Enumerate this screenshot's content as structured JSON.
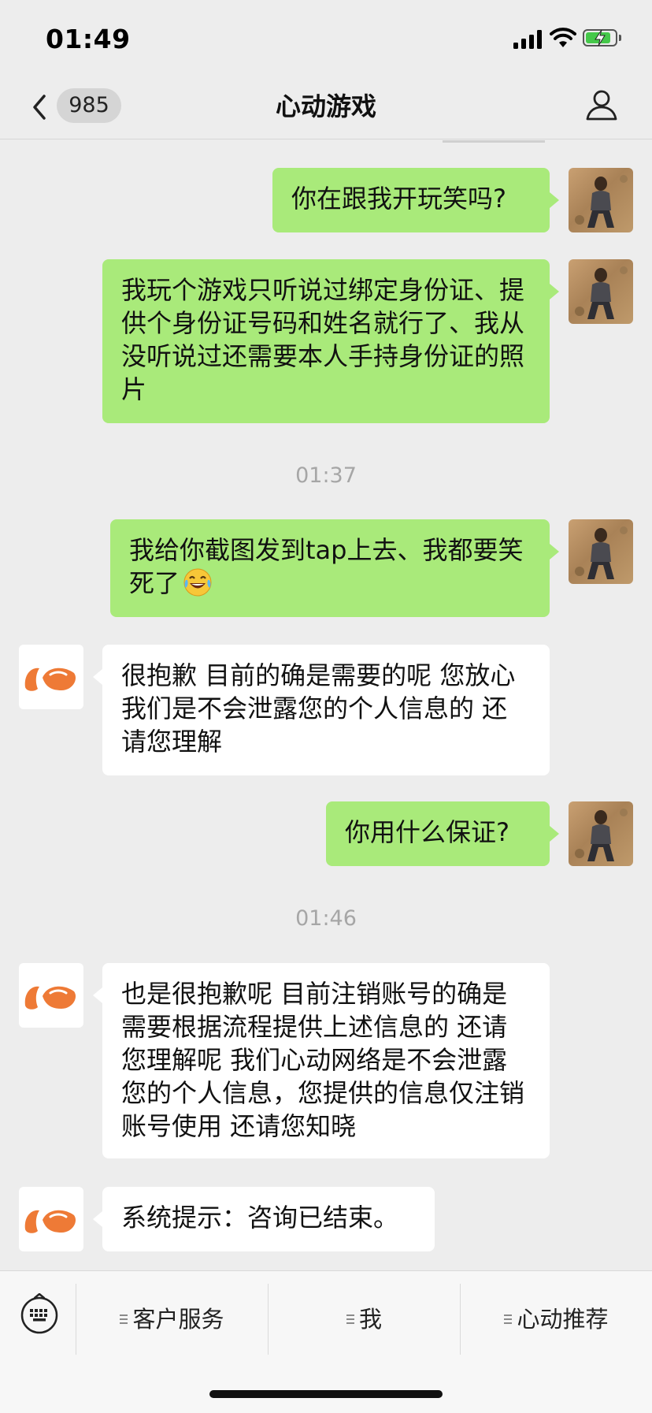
{
  "status_bar": {
    "time": "01:49",
    "battery_charging": true
  },
  "nav": {
    "unread_count": "985",
    "title": "心动游戏"
  },
  "messages": [
    {
      "side": "me",
      "text": "你在跟我开玩笑吗?"
    },
    {
      "side": "me",
      "text": "我玩个游戏只听说过绑定身份证、提供个身份证号码和姓名就行了、我从没听说过还需要本人手持身份证的照片"
    },
    {
      "type": "timestamp",
      "text": "01:37"
    },
    {
      "side": "me",
      "text": "我给你截图发到tap上去、我都要笑死了",
      "emoji": "face-with-tears-of-joy"
    },
    {
      "side": "them",
      "text": "很抱歉 目前的确是需要的呢 您放心我们是不会泄露您的个人信息的 还请您理解"
    },
    {
      "side": "me",
      "text": "你用什么保证?"
    },
    {
      "type": "timestamp",
      "text": "01:46"
    },
    {
      "side": "them",
      "text": "也是很抱歉呢 目前注销账号的确是需要根据流程提供上述信息的 还请您理解呢 我们心动网络是不会泄露您的个人信息，您提供的信息仅注销账号使用 还请您知晓"
    },
    {
      "side": "them",
      "text": "系统提示：咨询已结束。"
    }
  ],
  "bottom_menu": {
    "items": [
      "客户服务",
      "我",
      "心动推荐"
    ]
  },
  "colors": {
    "my_bubble": "#a9ea7a",
    "their_bubble": "#ffffff",
    "brand_orange": "#ee7a36",
    "background": "#ededed"
  }
}
